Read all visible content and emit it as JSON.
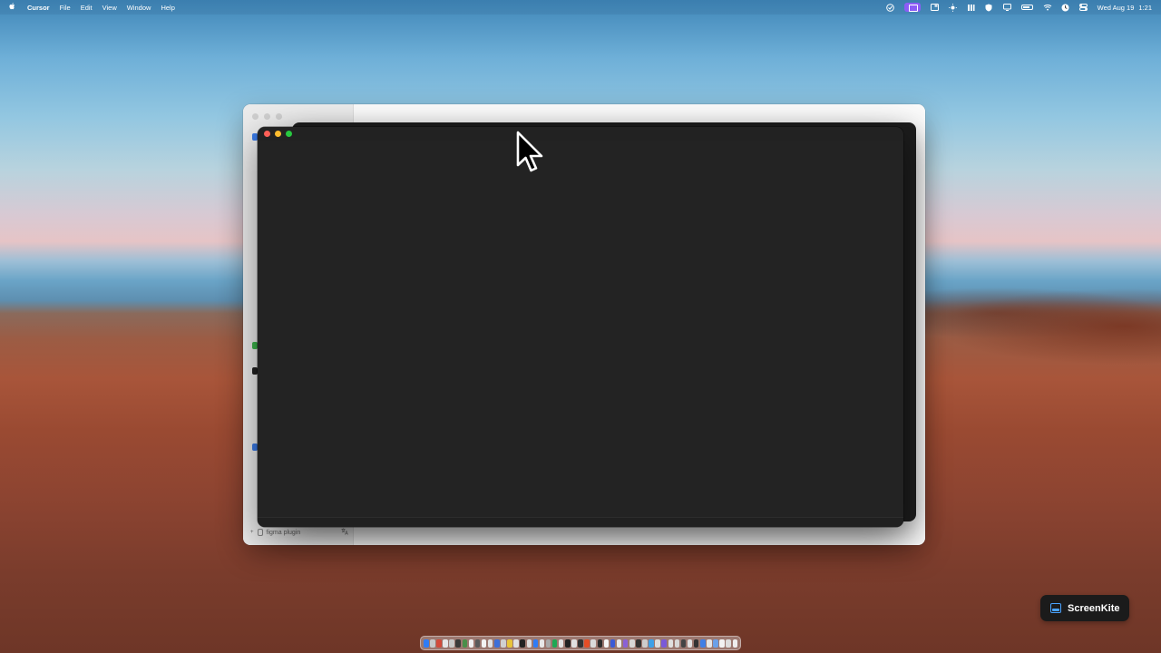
{
  "menubar": {
    "app_name": "Cursor",
    "menus": [
      "File",
      "Edit",
      "View",
      "Window",
      "Help"
    ],
    "clock": {
      "date": "Wed Aug 19",
      "time": "1:21"
    },
    "status_icons": [
      "vpn-icon",
      "screen-record-icon",
      "window-icon",
      "brightness-icon",
      "flower-icon",
      "shield-icon",
      "display-icon",
      "battery-icon",
      "wifi-icon",
      "timer-icon",
      "control-center-icon"
    ],
    "accent": "#8b5cf6"
  },
  "background_window": {
    "sidebar_footer": {
      "label": "figma plugin"
    }
  },
  "terminal_window": {
    "background": "#232323"
  },
  "dock": {
    "icon_colors": [
      "#2f7cf6",
      "#c8c8c8",
      "#d24a3a",
      "#e6e6e6",
      "#c9c9c9",
      "#3a3a3a",
      "#4a8f4a",
      "#f0f0f0",
      "#5a5a5a",
      "#f3f3f3",
      "#e0e0e0",
      "#3d6fd8",
      "#d0d0d0",
      "#e7c43a",
      "#e0e0e0",
      "#222222",
      "#dddddd",
      "#2f7cf6",
      "#e8e8e8",
      "#a8a8a8",
      "#1da854",
      "#e4e4e4",
      "#222222",
      "#e0e0e0",
      "#333333",
      "#e44d26",
      "#dadada",
      "#2d2d2d",
      "#f5f5f5",
      "#3b5bd6",
      "#e8e8e8",
      "#8a60d6",
      "#d6d6d6",
      "#333333",
      "#cccccc",
      "#3da0e8",
      "#dcdcdc",
      "#7a5ad8",
      "#e0e0e0",
      "#d8d8d8",
      "#444444",
      "#e0e0e0",
      "#333333",
      "#3f7fe6",
      "#e4e4e4",
      "#6aa0e8",
      "#f2f2f2",
      "#dddddd",
      "#eeeeee"
    ]
  },
  "badge": {
    "label": "ScreenKite",
    "accent": "#4aa3ff"
  }
}
